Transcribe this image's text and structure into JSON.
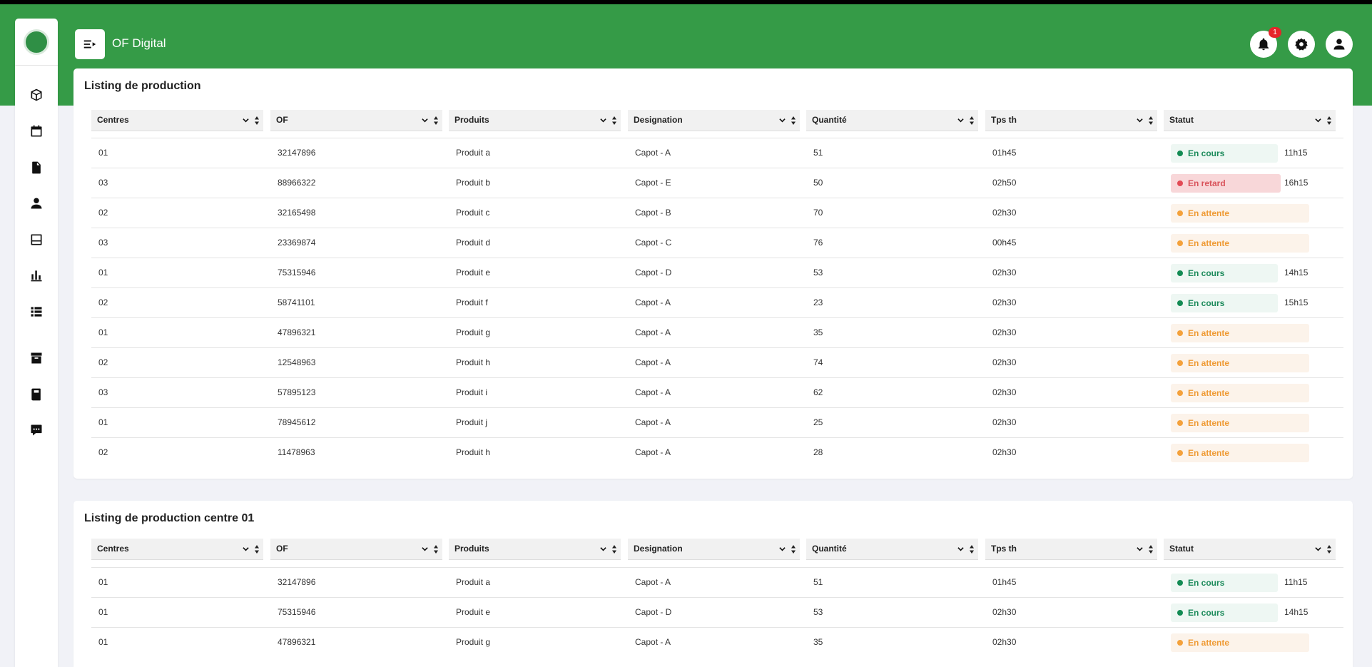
{
  "app": {
    "title": "OF Digital",
    "notifications_count": "1"
  },
  "sidebar": {
    "items": [
      {
        "icon": "cube-icon"
      },
      {
        "icon": "calendar-icon"
      },
      {
        "icon": "document-icon"
      },
      {
        "icon": "user-icon"
      },
      {
        "icon": "inbox-icon"
      },
      {
        "icon": "bar-chart-icon"
      },
      {
        "icon": "list-icon"
      },
      {
        "icon": "archive-icon"
      },
      {
        "icon": "book-icon"
      },
      {
        "icon": "chat-icon"
      }
    ]
  },
  "columns": [
    "Centres",
    "OF",
    "Produits",
    "Designation",
    "Quantité",
    "Tps th",
    "Statut"
  ],
  "status_colors": {
    "en_cours": "#138b54",
    "en_retard": "#e24a55",
    "en_attente": "#f4a13b",
    "header_green": "#359b47"
  },
  "listing1": {
    "title": "Listing de production",
    "rows": [
      {
        "centre": "01",
        "of": "32147896",
        "produit": "Produit a",
        "designation": "Capot - A",
        "quantite": "51",
        "tps": "01h45",
        "statut": "En cours",
        "kind": "cours",
        "time": "11h15"
      },
      {
        "centre": "03",
        "of": "88966322",
        "produit": "Produit b",
        "designation": "Capot - E",
        "quantite": "50",
        "tps": "02h50",
        "statut": "En retard",
        "kind": "retard",
        "time": "16h15"
      },
      {
        "centre": "02",
        "of": "32165498",
        "produit": "Produit c",
        "designation": "Capot - B",
        "quantite": "70",
        "tps": "02h30",
        "statut": "En attente",
        "kind": "attente",
        "time": ""
      },
      {
        "centre": "03",
        "of": "23369874",
        "produit": "Produit d",
        "designation": "Capot - C",
        "quantite": "76",
        "tps": "00h45",
        "statut": "En attente",
        "kind": "attente",
        "time": ""
      },
      {
        "centre": "01",
        "of": "75315946",
        "produit": "Produit e",
        "designation": "Capot - D",
        "quantite": "53",
        "tps": "02h30",
        "statut": "En cours",
        "kind": "cours",
        "time": "14h15"
      },
      {
        "centre": "02",
        "of": "58741101",
        "produit": "Produit f",
        "designation": "Capot - A",
        "quantite": "23",
        "tps": "02h30",
        "statut": "En cours",
        "kind": "cours",
        "time": "15h15"
      },
      {
        "centre": "01",
        "of": "47896321",
        "produit": "Produit g",
        "designation": "Capot - A",
        "quantite": "35",
        "tps": "02h30",
        "statut": "En attente",
        "kind": "attente",
        "time": ""
      },
      {
        "centre": "02",
        "of": "12548963",
        "produit": "Produit h",
        "designation": "Capot - A",
        "quantite": "74",
        "tps": "02h30",
        "statut": "En attente",
        "kind": "attente",
        "time": ""
      },
      {
        "centre": "03",
        "of": "57895123",
        "produit": "Produit i",
        "designation": "Capot - A",
        "quantite": "62",
        "tps": "02h30",
        "statut": "En attente",
        "kind": "attente",
        "time": ""
      },
      {
        "centre": "01",
        "of": "78945612",
        "produit": "Produit j",
        "designation": "Capot - A",
        "quantite": "25",
        "tps": "02h30",
        "statut": "En attente",
        "kind": "attente",
        "time": ""
      },
      {
        "centre": "02",
        "of": "11478963",
        "produit": "Produit h",
        "designation": "Capot - A",
        "quantite": "28",
        "tps": "02h30",
        "statut": "En attente",
        "kind": "attente",
        "time": ""
      }
    ]
  },
  "listing2": {
    "title": "Listing de production centre 01",
    "rows": [
      {
        "centre": "01",
        "of": "32147896",
        "produit": "Produit a",
        "designation": "Capot - A",
        "quantite": "51",
        "tps": "01h45",
        "statut": "En cours",
        "kind": "cours",
        "time": "11h15"
      },
      {
        "centre": "01",
        "of": "75315946",
        "produit": "Produit e",
        "designation": "Capot - D",
        "quantite": "53",
        "tps": "02h30",
        "statut": "En cours",
        "kind": "cours",
        "time": "14h15"
      },
      {
        "centre": "01",
        "of": "47896321",
        "produit": "Produit g",
        "designation": "Capot - A",
        "quantite": "35",
        "tps": "02h30",
        "statut": "En attente",
        "kind": "attente",
        "time": ""
      }
    ]
  }
}
